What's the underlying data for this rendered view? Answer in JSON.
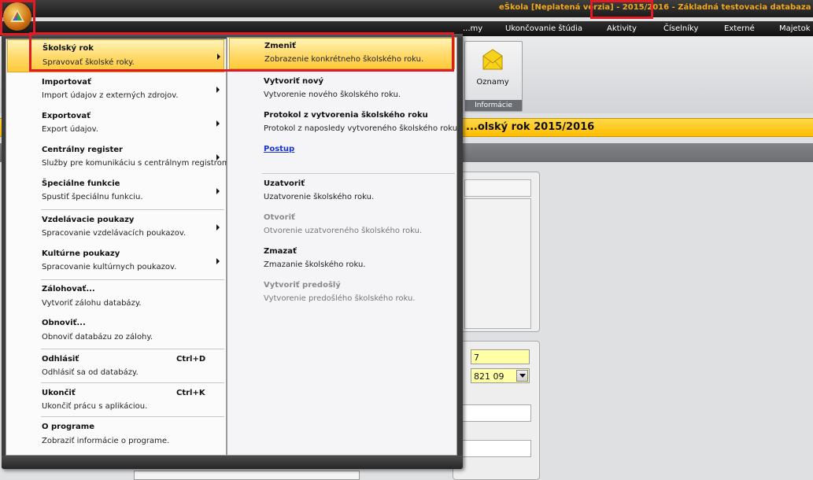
{
  "title_bar": {
    "text": "eŠkola [Neplatená verzia] - 2015/2016 - Základná testovacia databaza"
  },
  "menu_tabs": [
    "...my",
    "Ukončovanie štúdia",
    "Aktivity",
    "Číselníky",
    "Externé",
    "Majetok"
  ],
  "ribbon": {
    "button_label": "Oznamy",
    "group_label": "Informácie"
  },
  "content": {
    "header_title": "...olský rok 2015/2016",
    "field_number": "7",
    "field_code": "821 09"
  },
  "app_menu": {
    "left_items": [
      {
        "title": "Školský rok",
        "desc": "Spravovať školské roky.",
        "submenu": true
      },
      {
        "title": "Importovať",
        "desc": "Import údajov z externých zdrojov.",
        "submenu": true
      },
      {
        "title": "Exportovať",
        "desc": "Export údajov.",
        "submenu": true
      },
      {
        "title": "Centrálny register",
        "desc": "Služby pre komunikáciu s centrálnym registrom.",
        "submenu": true
      },
      {
        "title": "Špeciálne funkcie",
        "desc": "Spustiť špeciálnu funkciu.",
        "submenu": true
      },
      {
        "title": "Vzdelávacie poukazy",
        "desc": "Spracovanie vzdelávacích poukazov.",
        "submenu": true
      },
      {
        "title": "Kultúrne poukazy",
        "desc": "Spracovanie kultúrnych poukazov.",
        "submenu": true
      },
      {
        "title": "Zálohovať...",
        "desc": "Vytvoriť zálohu databázy."
      },
      {
        "title": "Obnoviť...",
        "desc": "Obnoviť databázu zo zálohy."
      },
      {
        "title": "Odhlásiť",
        "desc": "Odhlásiť sa od databázy.",
        "shortcut": "Ctrl+D"
      },
      {
        "title": "Ukončiť",
        "desc": "Ukončiť prácu s aplikáciou.",
        "shortcut": "Ctrl+K"
      },
      {
        "title": "O programe",
        "desc": "Zobraziť informácie o programe."
      }
    ],
    "right_items": [
      {
        "title": "Zmeniť",
        "desc": "Zobrazenie konkrétneho školského roku."
      },
      {
        "title": "Vytvoriť nový",
        "desc": "Vytvorenie nového školského roku."
      },
      {
        "title": "Protokol z vytvorenia školského roku",
        "desc": "Protokol z naposledy vytvoreného školského roku."
      },
      {
        "title": "Postup"
      },
      {
        "title": "Uzatvoriť",
        "desc": "Uzatvorenie školského roku."
      },
      {
        "title": "Otvoriť",
        "desc": "Otvorenie uzatvoreného školského roku.",
        "disabled": true
      },
      {
        "title": "Zmazať",
        "desc": "Zmazanie školského roku."
      },
      {
        "title": "Vytvoriť predošlý",
        "desc": "Vytvorenie predošlého školského roku.",
        "disabled": true
      }
    ]
  },
  "colors": {
    "accent_yellow": "#ffc000",
    "title_orange": "#f0a81e",
    "highlight_red": "#e01b24",
    "link_blue": "#1a32d0"
  },
  "icons": [
    "app-orb-icon",
    "envelope-icon",
    "submenu-arrow-icon",
    "dropdown-arrow-icon"
  ]
}
